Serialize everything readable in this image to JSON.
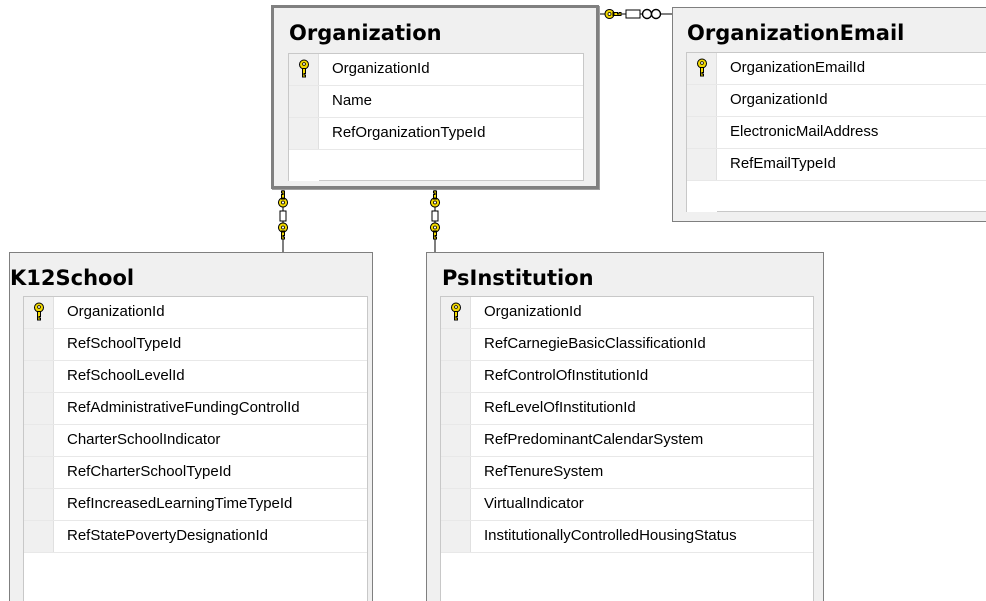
{
  "colors": {
    "key_fill": "#f2d900",
    "key_stroke": "#000000",
    "connector": "#7f7f7f"
  },
  "tables": {
    "organization": {
      "title": "Organization",
      "columns": [
        {
          "name": "OrganizationId",
          "primary_key": true
        },
        {
          "name": "Name",
          "primary_key": false
        },
        {
          "name": "RefOrganizationTypeId",
          "primary_key": false
        }
      ]
    },
    "organization_email": {
      "title": "OrganizationEmail",
      "columns": [
        {
          "name": "OrganizationEmailId",
          "primary_key": true
        },
        {
          "name": "OrganizationId",
          "primary_key": false
        },
        {
          "name": "ElectronicMailAddress",
          "primary_key": false
        },
        {
          "name": "RefEmailTypeId",
          "primary_key": false
        }
      ]
    },
    "k12_school": {
      "title": "K12School",
      "columns": [
        {
          "name": "OrganizationId",
          "primary_key": true
        },
        {
          "name": "RefSchoolTypeId",
          "primary_key": false
        },
        {
          "name": "RefSchoolLevelId",
          "primary_key": false
        },
        {
          "name": "RefAdministrativeFundingControlId",
          "primary_key": false
        },
        {
          "name": "CharterSchoolIndicator",
          "primary_key": false
        },
        {
          "name": "RefCharterSchoolTypeId",
          "primary_key": false
        },
        {
          "name": "RefIncreasedLearningTimeTypeId",
          "primary_key": false
        },
        {
          "name": "RefStatePovertyDesignationId",
          "primary_key": false
        }
      ]
    },
    "ps_institution": {
      "title": "PsInstitution",
      "columns": [
        {
          "name": "OrganizationId",
          "primary_key": true
        },
        {
          "name": "RefCarnegieBasicClassificationId",
          "primary_key": false
        },
        {
          "name": "RefControlOfInstitutionId",
          "primary_key": false
        },
        {
          "name": "RefLevelOfInstitutionId",
          "primary_key": false
        },
        {
          "name": "RefPredominantCalendarSystem",
          "primary_key": false
        },
        {
          "name": "RefTenureSystem",
          "primary_key": false
        },
        {
          "name": "VirtualIndicator",
          "primary_key": false
        },
        {
          "name": "InstitutionallyControlledHousingStatus",
          "primary_key": false
        }
      ]
    }
  },
  "relationships": [
    {
      "from": "organization",
      "to": "organization_email",
      "from_end": "one",
      "to_end": "many"
    },
    {
      "from": "organization",
      "to": "k12_school",
      "from_end": "one",
      "to_end": "one"
    },
    {
      "from": "organization",
      "to": "ps_institution",
      "from_end": "one",
      "to_end": "one"
    }
  ]
}
